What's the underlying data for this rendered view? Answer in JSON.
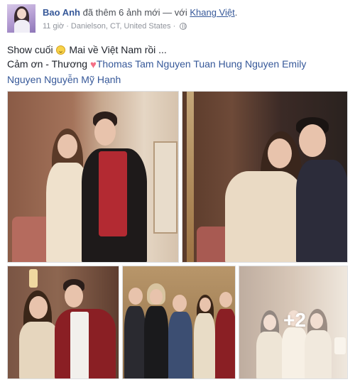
{
  "post": {
    "author": "Bao Anh",
    "action": "đã thêm 6 ảnh mới — với",
    "tagged": "Khang Việt",
    "time": "11 giờ",
    "separator": "·",
    "location": "Danielson, CT, United States",
    "separator2": "·",
    "privacy_icon": "globe-icon",
    "text": {
      "line1_before": "Show cuối",
      "line1_after": "Mai về Việt Nam rồi ...",
      "line2_before": "Cảm ơn - Thương",
      "line2_links": "Thomas Tam Nguyen Tuan Hung Nguyen Emily",
      "line3_links": "Nguyen Nguyễn Mỹ Hạnh",
      "emoji_icon": "smile-icon",
      "heart_icon": "heart-icon"
    }
  },
  "photos": {
    "more_count": "+2"
  },
  "colors": {
    "link": "#365899",
    "meta": "#90949c",
    "text": "#1d2129",
    "heart": "#f46f86"
  }
}
